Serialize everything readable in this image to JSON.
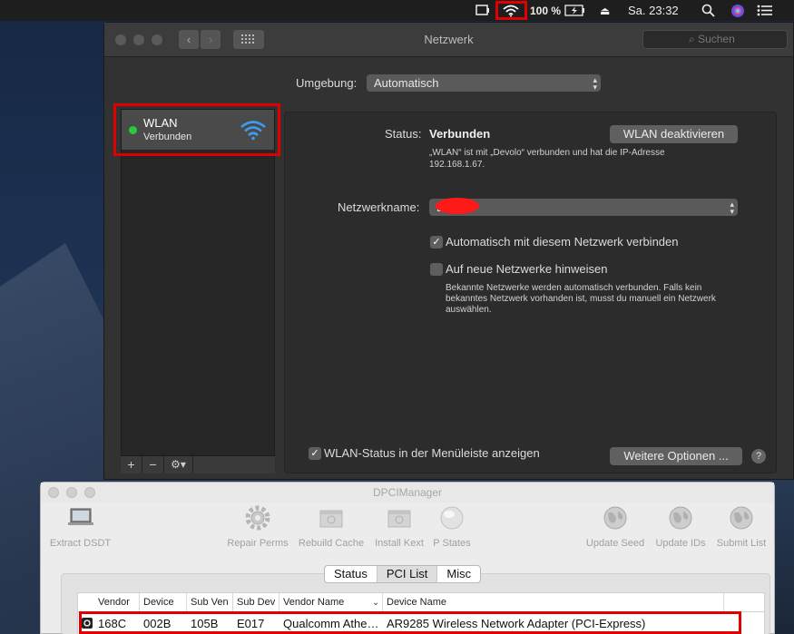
{
  "menubar": {
    "battery_pct": "100 %",
    "clock": "Sa. 23:32"
  },
  "window": {
    "title": "Netzwerk",
    "search_placeholder": "Suchen"
  },
  "location": {
    "label": "Umgebung:",
    "value": "Automatisch"
  },
  "sidebar": {
    "items": [
      {
        "name": "WLAN",
        "status": "Verbunden",
        "status_color": "#27c93f"
      }
    ]
  },
  "status": {
    "label": "Status:",
    "value": "Verbunden",
    "toggle_button": "WLAN deaktivieren",
    "description_line1": "„WLAN“ ist mit „Devolo“ verbunden und hat die IP-Adresse",
    "description_line2": "192.168.1.67."
  },
  "network_name": {
    "label": "Netzwerkname:",
    "value": "Devolo"
  },
  "options": {
    "auto_join_label": "Automatisch mit diesem Netzwerk verbinden",
    "auto_join_checked": true,
    "ask_new_label": "Auf neue Netzwerke hinweisen",
    "ask_new_checked": false,
    "hint_line1": "Bekannte Netzwerke werden automatisch verbunden. Falls kein",
    "hint_line2": "bekanntes Netzwerk vorhanden ist, musst du manuell ein Netzwerk",
    "hint_line3": "auswählen."
  },
  "footer": {
    "show_status_label": "WLAN-Status in der Menüleiste anzeigen",
    "more_options": "Weitere Optionen ...",
    "help": "?"
  },
  "sidebar_buttons": {
    "add": "+",
    "remove": "−"
  },
  "dpci": {
    "title": "DPCIManager",
    "tools": [
      "Extract DSDT",
      "Repair Perms",
      "Rebuild Cache",
      "Install Kext",
      "P States",
      "Update Seed",
      "Update IDs",
      "Submit List"
    ],
    "tabs": [
      "Status",
      "PCI List",
      "Misc"
    ],
    "selected_tab": "PCI List",
    "columns": [
      "Vendor",
      "Device",
      "Sub Ven",
      "Sub Dev",
      "Vendor Name",
      "Device Name"
    ],
    "rows": [
      [
        "168C",
        "002B",
        "105B",
        "E017",
        "Qualcomm Athe…",
        "AR9285 Wireless Network Adapter (PCI-Express)"
      ]
    ]
  },
  "colors": {
    "highlight": "#e00000",
    "wifi_blue": "#3d9bf0"
  }
}
